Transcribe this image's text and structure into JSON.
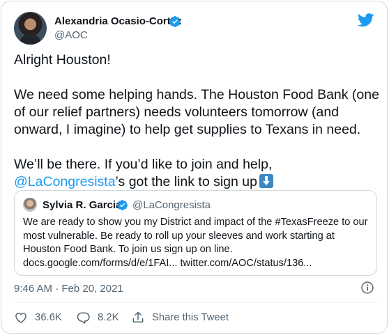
{
  "author": {
    "name": "Alexandria Ocasio-Cortez",
    "handle": "@AOC",
    "verified": true
  },
  "tweet": {
    "paragraph1": "Alright Houston!",
    "paragraph2": "We need some helping hands. The Houston Food Bank (one of our relief partners) needs volunteers tomorrow (and onward, I imagine) to help get supplies to Texans in need.",
    "paragraph3_start": "We’ll be there. If you’d like to join and help, ",
    "paragraph3_mention": "@LaCongresista",
    "paragraph3_end": "’s got the link to sign up",
    "arrow_emoji": "down-arrow-emoji"
  },
  "quoted_tweet": {
    "name": "Sylvia R. Garcia",
    "handle": "@LaCongresista",
    "verified": true,
    "text": "We are ready to show you my District and impact of the #TexasFreeze to our most vulnerable. Be ready to roll up your sleeves and work starting at Houston Food Bank. To join us sign up on line. docs.google.com/forms/d/e/1FAI... twitter.com/AOC/status/136..."
  },
  "timestamp": "9:46 AM · Feb 20, 2021",
  "actions": {
    "likes": "36.6K",
    "replies": "8.2K",
    "share_label": "Share this Tweet"
  },
  "colors": {
    "accent": "#1d9bf0",
    "text": "#0f1419",
    "secondary": "#536471",
    "border": "#cfd9de"
  },
  "icons": [
    "verified-badge-icon",
    "twitter-bird-icon",
    "info-icon",
    "heart-icon",
    "reply-icon",
    "share-icon"
  ]
}
